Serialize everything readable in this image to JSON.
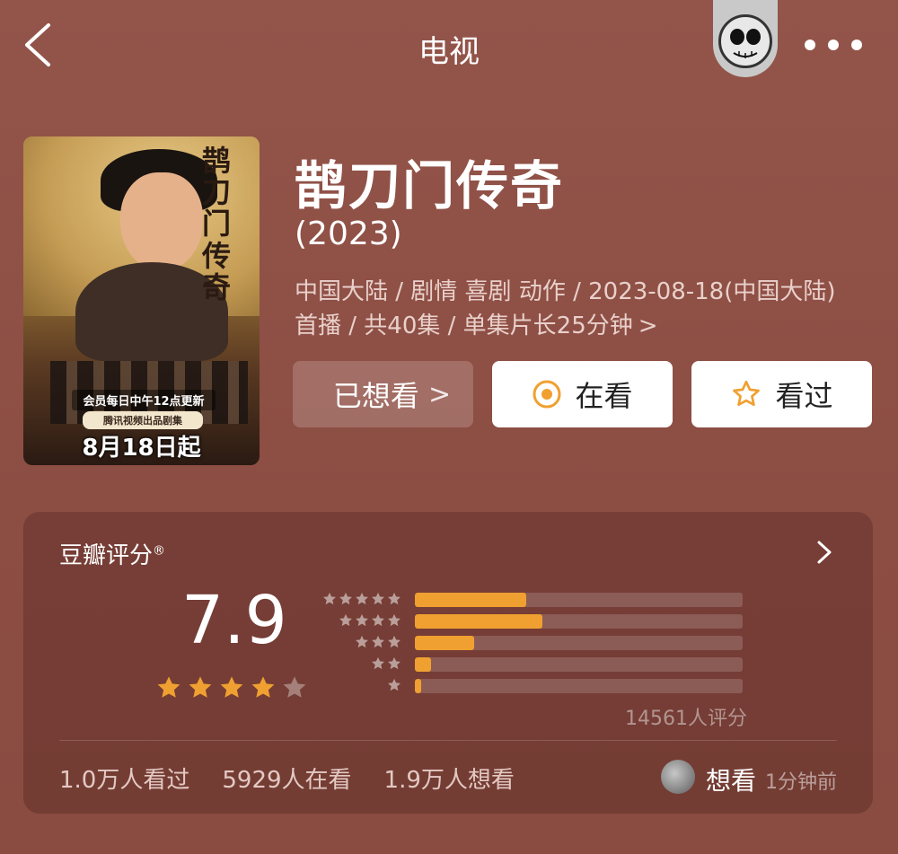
{
  "header": {
    "title": "电视"
  },
  "poster": {
    "title_art": "鹊刀门传奇",
    "update_text": "会员每日中午12点更新",
    "producer_text": "腾讯视频出品剧集",
    "date_text": "8月18日起"
  },
  "info": {
    "title": "鹊刀门传奇",
    "year": "(2023)",
    "meta_line1": "中国大陆 / 剧情 喜剧 动作 / 2023-08-18(中国大陆)",
    "meta_line2": "首播 / 共40集 / 单集片长25分钟",
    "meta_chevron": ">"
  },
  "actions": {
    "wanted_label": "已想看",
    "wanted_arrow": ">",
    "watching_label": "在看",
    "watched_label": "看过"
  },
  "rating": {
    "title": "豆瓣评分",
    "registered_mark": "®",
    "score": "7.9",
    "score_stars": 4,
    "distribution": [
      {
        "stars": 5,
        "fraction": 0.34
      },
      {
        "stars": 4,
        "fraction": 0.39
      },
      {
        "stars": 3,
        "fraction": 0.18
      },
      {
        "stars": 2,
        "fraction": 0.05
      },
      {
        "stars": 1,
        "fraction": 0.02
      }
    ],
    "count_text": "14561人评分",
    "stats": {
      "watched": "1.0万人看过",
      "watching": "5929人在看",
      "wanted": "1.9万人想看"
    },
    "user_action": "想看",
    "user_time": "1分钟前"
  },
  "colors": {
    "background": "#8f4f44",
    "star": "#f0a030",
    "bar": "#f0a030"
  }
}
